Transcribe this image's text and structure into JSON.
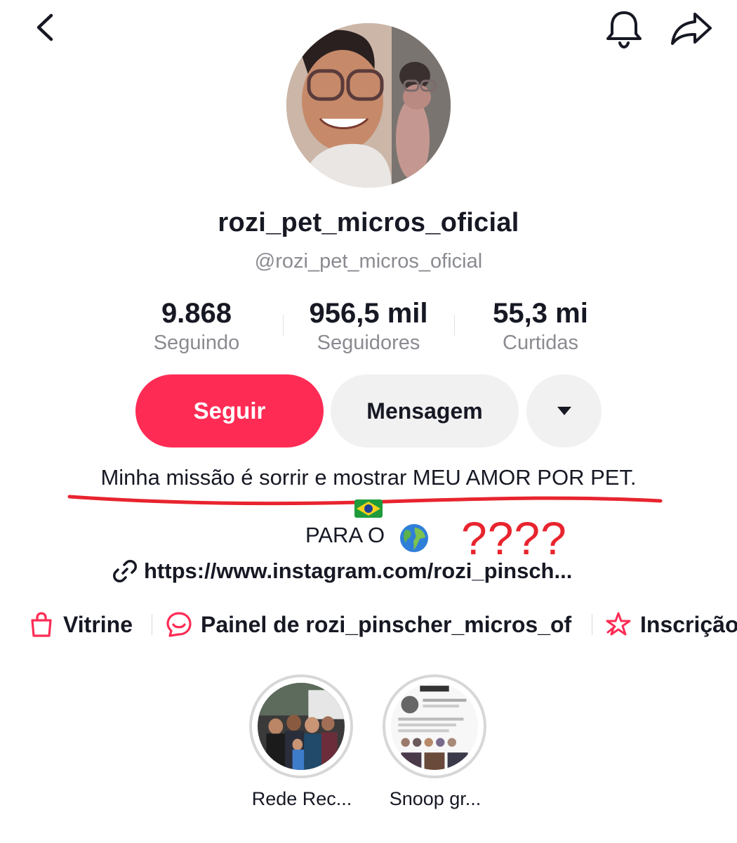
{
  "topbar": {
    "back_icon": "chevron-left-icon",
    "bell_icon": "bell-icon",
    "share_icon": "share-arrow-icon"
  },
  "profile": {
    "display_name": "rozi_pet_micros_oficial",
    "username": "@rozi_pet_micros_oficial"
  },
  "stats": [
    {
      "value": "9.868",
      "label": "Seguindo"
    },
    {
      "value": "956,5 mil",
      "label": "Seguidores"
    },
    {
      "value": "55,3 mi",
      "label": "Curtidas"
    }
  ],
  "actions": {
    "follow_label": "Seguir",
    "message_label": "Mensagem",
    "more_icon": "caret-down-icon"
  },
  "bio": {
    "line1": "Minha missão é sorrir e mostrar MEU AMOR POR PET.",
    "line2": "PARA O",
    "flag_icon": "brazil-flag-icon",
    "globe_icon": "globe-icon",
    "annotation": "????",
    "link": "https://www.instagram.com/rozi_pinsch..."
  },
  "chips": [
    {
      "icon": "shopping-bag-icon",
      "label": "Vitrine"
    },
    {
      "icon": "chat-panel-icon",
      "label": "Painel de rozi_pinscher_micros_of"
    },
    {
      "icon": "star-badge-icon",
      "label": "Inscrição"
    }
  ],
  "highlights": [
    {
      "label": "Rede Rec..."
    },
    {
      "label": "Snoop gr..."
    }
  ],
  "colors": {
    "accent": "#fe2c55",
    "annotation_red": "#e8242e",
    "secondary_text": "#8a8b91",
    "button_gray": "#f1f1f2"
  }
}
